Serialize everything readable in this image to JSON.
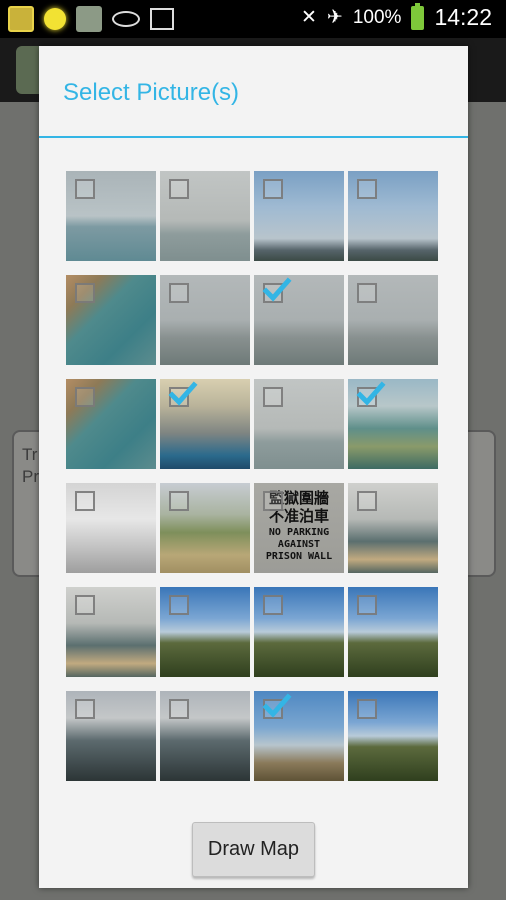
{
  "status_bar": {
    "battery": "100%",
    "time": "14:22",
    "colors": {
      "battery": "#7ec83a"
    }
  },
  "background": {
    "text_line1": "Tr",
    "text_line2": "Pr"
  },
  "dialog": {
    "title": "Select Picture(s)",
    "accent": "#33b5e5",
    "button_label": "Draw Map",
    "pictures": [
      {
        "checked": false,
        "theme": "harbour-haze"
      },
      {
        "checked": false,
        "theme": "haze-sea"
      },
      {
        "checked": false,
        "theme": "towers"
      },
      {
        "checked": false,
        "theme": "towers"
      },
      {
        "checked": false,
        "theme": "coast-aerial"
      },
      {
        "checked": false,
        "theme": "bridge-haze"
      },
      {
        "checked": true,
        "theme": "bridge-haze"
      },
      {
        "checked": false,
        "theme": "bridge-haze"
      },
      {
        "checked": false,
        "theme": "coast-aerial"
      },
      {
        "checked": true,
        "theme": "aircraft"
      },
      {
        "checked": false,
        "theme": "haze-sea"
      },
      {
        "checked": true,
        "theme": "coast-bay"
      },
      {
        "checked": false,
        "theme": "building"
      },
      {
        "checked": false,
        "theme": "dam"
      },
      {
        "checked": false,
        "theme": "sign"
      },
      {
        "checked": false,
        "theme": "beach"
      },
      {
        "checked": false,
        "theme": "beach"
      },
      {
        "checked": false,
        "theme": "hills-sky"
      },
      {
        "checked": false,
        "theme": "hills-sky"
      },
      {
        "checked": false,
        "theme": "hills-sky"
      },
      {
        "checked": false,
        "theme": "hills-dark"
      },
      {
        "checked": false,
        "theme": "hills-dark"
      },
      {
        "checked": true,
        "theme": "hut"
      },
      {
        "checked": false,
        "theme": "hills-sky"
      }
    ],
    "sign": {
      "line1": "監獄圍牆",
      "line2": "不准泊車",
      "line3": "NO PARKING",
      "line4": "AGAINST",
      "line5": "PRISON WALL"
    }
  }
}
